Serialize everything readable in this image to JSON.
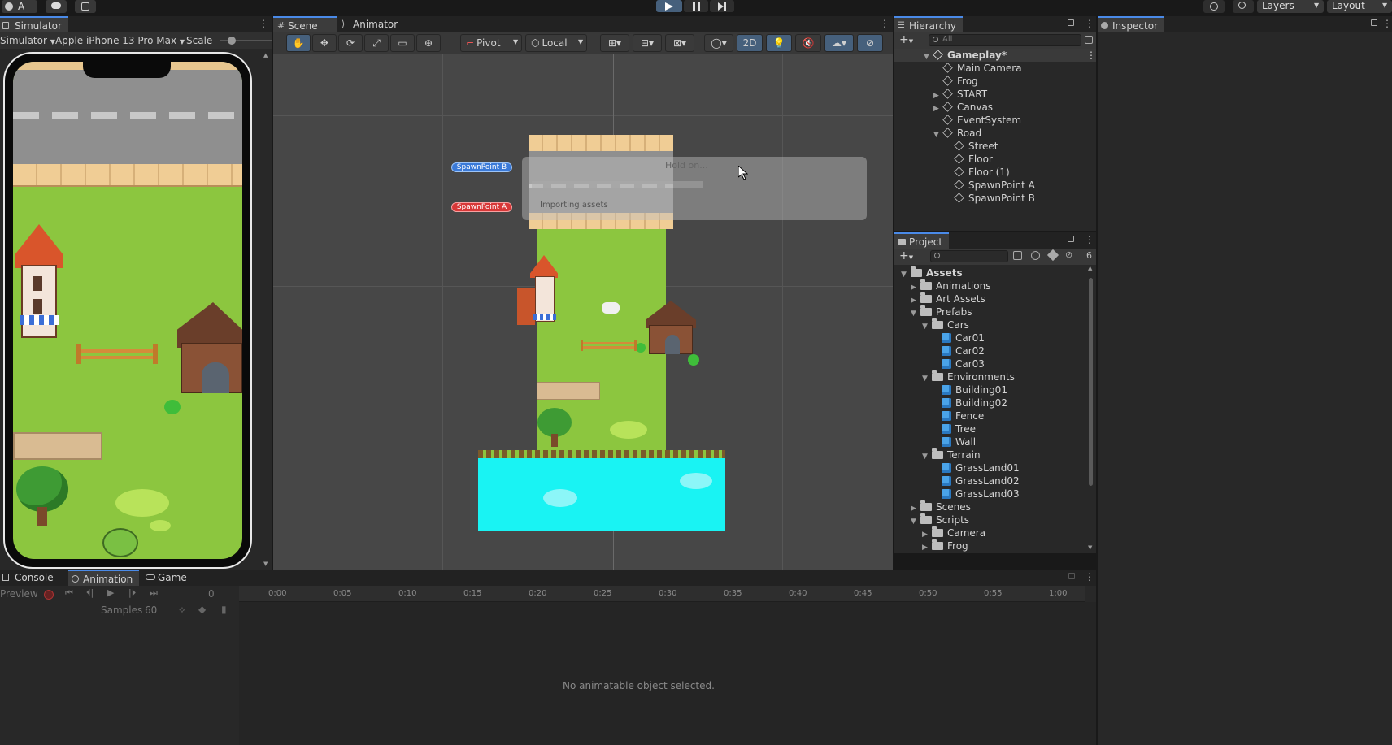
{
  "topbar": {
    "account_label": "A",
    "layers_label": "Layers",
    "layout_label": "Layout"
  },
  "simulator": {
    "tab_label": "Simulator",
    "mode_label": "Simulator",
    "device_label": "Apple iPhone 13 Pro Max",
    "scale_label": "Scale"
  },
  "scene": {
    "tabs": [
      {
        "label": "Scene"
      },
      {
        "label": "Animator"
      }
    ],
    "pivot_label": "Pivot",
    "local_label": "Local",
    "mode_2d_label": "2D",
    "spawn_b_label": "SpawnPoint B",
    "spawn_a_label": "SpawnPoint A",
    "progress_dialog": {
      "title": "Hold on...",
      "message": "Importing assets"
    }
  },
  "hierarchy": {
    "tab_label": "Hierarchy",
    "search_placeholder": "All",
    "root": "Gameplay*",
    "items": [
      {
        "label": "Main Camera"
      },
      {
        "label": "Frog"
      },
      {
        "label": "START"
      },
      {
        "label": "Canvas"
      },
      {
        "label": "EventSystem"
      },
      {
        "label": "Road"
      },
      {
        "label": "Street"
      },
      {
        "label": "Floor"
      },
      {
        "label": "Floor (1)"
      },
      {
        "label": "SpawnPoint A"
      },
      {
        "label": "SpawnPoint B"
      }
    ]
  },
  "project": {
    "tab_label": "Project",
    "hidden_count": "6",
    "items": [
      {
        "label": "Assets"
      },
      {
        "label": "Animations"
      },
      {
        "label": "Art Assets"
      },
      {
        "label": "Prefabs"
      },
      {
        "label": "Cars"
      },
      {
        "label": "Car01"
      },
      {
        "label": "Car02"
      },
      {
        "label": "Car03"
      },
      {
        "label": "Environments"
      },
      {
        "label": "Building01"
      },
      {
        "label": "Building02"
      },
      {
        "label": "Fence"
      },
      {
        "label": "Tree"
      },
      {
        "label": "Wall"
      },
      {
        "label": "Terrain"
      },
      {
        "label": "GrassLand01"
      },
      {
        "label": "GrassLand02"
      },
      {
        "label": "GrassLand03"
      },
      {
        "label": "Scenes"
      },
      {
        "label": "Scripts"
      },
      {
        "label": "Camera"
      },
      {
        "label": "Frog"
      }
    ]
  },
  "inspector": {
    "tab_label": "Inspector"
  },
  "bottom": {
    "tabs": [
      {
        "label": "Console"
      },
      {
        "label": "Animation"
      },
      {
        "label": "Game"
      }
    ],
    "preview_label": "Preview",
    "frame_value": "0",
    "samples_label": "Samples",
    "samples_value": "60",
    "timeline_ticks": [
      "0:00",
      "0:05",
      "0:10",
      "0:15",
      "0:20",
      "0:25",
      "0:30",
      "0:35",
      "0:40",
      "0:45",
      "0:50",
      "0:55",
      "1:00"
    ],
    "empty_message": "No animatable object selected."
  },
  "colors": {
    "accent": "#4a8ae8",
    "grass": "#8cc63f",
    "water": "#19f3f3"
  }
}
